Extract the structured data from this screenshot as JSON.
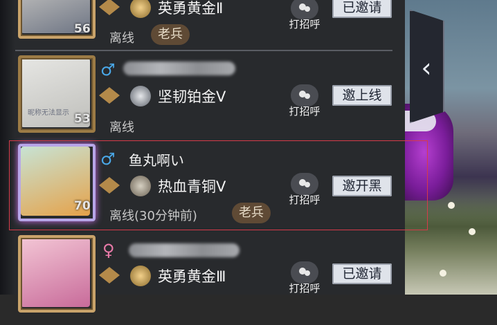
{
  "friends": [
    {
      "rank": "英勇黄金Ⅱ",
      "level": "56",
      "status": "离线",
      "tag": "老兵",
      "greet": "打招呼",
      "action": "已邀请",
      "gender": "♂"
    },
    {
      "rank": "坚韧铂金Ⅴ",
      "level": "53",
      "status": "离线",
      "greet": "打招呼",
      "action": "邀上线",
      "gender": "♂",
      "avatar_caption": "昵称无法显示"
    },
    {
      "name": "鱼丸啊い",
      "rank": "热血青铜Ⅴ",
      "level": "70",
      "status": "离线(30分钟前)",
      "tag": "老兵",
      "greet": "打招呼",
      "action": "邀开黑",
      "gender": "♂"
    },
    {
      "rank": "英勇黄金Ⅲ",
      "status": "",
      "greet": "打招呼",
      "action": "已邀请",
      "gender": "♀"
    }
  ],
  "icons": {
    "collapse": "chevron-left-icon",
    "greet": "chat-bubble-icon",
    "rank_badge": "rank-wing-icon"
  },
  "colors": {
    "male": "#4aa8e8",
    "female": "#e87aa8",
    "button_bg": "#dfe3ea",
    "highlight": "#d63b4a"
  }
}
